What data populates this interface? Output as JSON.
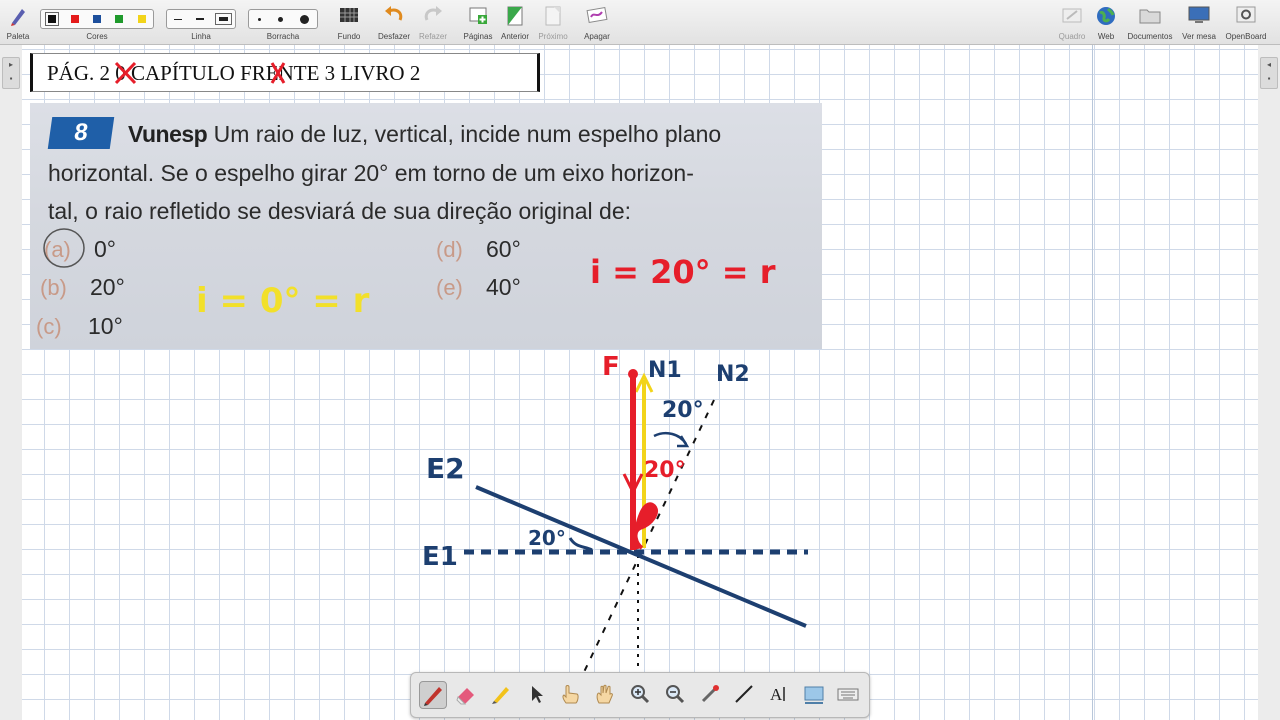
{
  "toolbar": {
    "palette_label": "Paleta",
    "colors_label": "Cores",
    "line_label": "Linha",
    "eraser_label": "Borracha",
    "background_label": "Fundo",
    "undo_label": "Desfazer",
    "redo_label": "Refazer",
    "pages_label": "Páginas",
    "previous_label": "Anterior",
    "next_label": "Próximo",
    "erase_label": "Apagar",
    "board_label": "Quadro",
    "web_label": "Web",
    "documents_label": "Documentos",
    "desktop_label": "Ver mesa",
    "openboard_label": "OpenBoard",
    "colors": [
      "#111111",
      "#e41b1b",
      "#1d4f9c",
      "#1f9a2c",
      "#f2d41a"
    ]
  },
  "header": {
    "text": "PÁG. 2 0  CAPÍTULO   FRENTE 3 LIVRO 2"
  },
  "question": {
    "number": "8",
    "source": "Vunesp",
    "line1": " Um raio de luz, vertical, incide num espelho plano",
    "line2": "horizontal. Se o espelho girar 20° em torno de um eixo horizon-",
    "line3": "tal, o raio refletido se desviará de sua direção original de:",
    "options": [
      {
        "letter": "(a)",
        "value": "0°"
      },
      {
        "letter": "(b)",
        "value": "20°"
      },
      {
        "letter": "(c)",
        "value": "10°"
      },
      {
        "letter": "(d)",
        "value": "60°"
      },
      {
        "letter": "(e)",
        "value": "40°"
      }
    ],
    "annotation_yellow": "i = 0° = r",
    "annotation_red": "i = 20° = r"
  },
  "diagram": {
    "label_F": "F",
    "label_N1": "N1",
    "label_N2": "N2",
    "label_E1": "E1",
    "label_E2": "E2",
    "angle_top": "20°",
    "angle_mid": "20°",
    "angle_mirror": "20°"
  }
}
